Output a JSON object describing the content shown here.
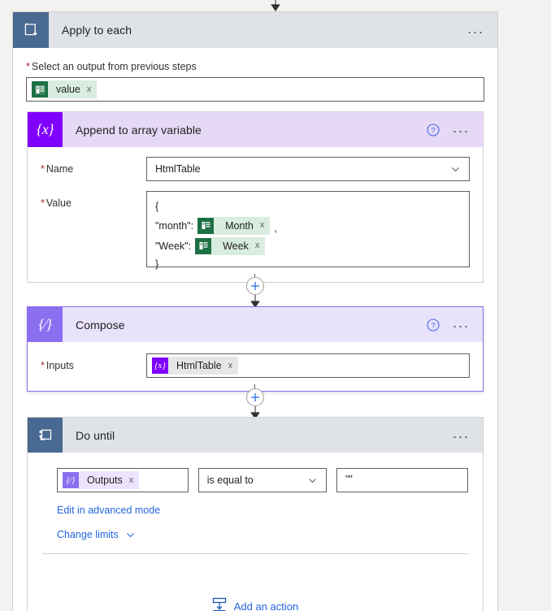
{
  "theme": {
    "page_bg": "#f3f2f1",
    "accent_blue": "#2266dd",
    "required_red": "#a4262c",
    "scope_icon_bg": "#486991",
    "variable_icon_bg": "#8000ff",
    "compose_icon_bg": "#8b6ff0",
    "excel_green": "#1d7044",
    "selected_outline": "#8b6ff0"
  },
  "apply_to_each": {
    "title": "Apply to each",
    "icon": "loop-icon",
    "menu_label": "...",
    "input": {
      "label": "Select an output from previous steps",
      "required_marker": "*",
      "token": {
        "text": "value",
        "icon": "excel-icon",
        "remove_label": "x"
      }
    }
  },
  "append_to_array": {
    "title": "Append to array variable",
    "icon": "variable-braces-icon",
    "help_label": "?",
    "menu_label": "...",
    "name_field": {
      "label": "Name",
      "required_marker": "*",
      "value": "HtmlTable",
      "chevron": "chevron-down-icon"
    },
    "value_field": {
      "label": "Value",
      "required_marker": "*",
      "lines": [
        {
          "text": "{",
          "token": null,
          "trailing": ""
        },
        {
          "text": "\"month\":",
          "token": {
            "text": "Month",
            "icon": "excel-icon",
            "remove_label": "x"
          },
          "trailing": ","
        },
        {
          "text": "\"Week\":",
          "token": {
            "text": "Week",
            "icon": "excel-icon",
            "remove_label": "x"
          },
          "trailing": ""
        },
        {
          "text": "}",
          "token": null,
          "trailing": ""
        }
      ]
    }
  },
  "compose": {
    "title": "Compose",
    "icon": "compose-braces-icon",
    "help_label": "?",
    "menu_label": "...",
    "selected": true,
    "inputs_field": {
      "label": "Inputs",
      "required_marker": "*",
      "token": {
        "text": "HtmlTable",
        "icon": "variable-braces-icon",
        "remove_label": "x"
      }
    }
  },
  "do_until": {
    "title": "Do until",
    "icon": "do-until-icon",
    "menu_label": "...",
    "condition": {
      "left_token": {
        "text": "Outputs",
        "icon": "compose-braces-icon",
        "remove_label": "x"
      },
      "operator": "is equal to",
      "operator_chevron": "chevron-down-icon",
      "right_value": "\"\"",
      "right_placeholder": ""
    },
    "advanced_link": "Edit in advanced mode",
    "change_limits_link": "Change limits",
    "change_limits_chevron": "chevron-down-icon",
    "add_action": {
      "label": "Add an action",
      "icon": "add-action-icon"
    }
  }
}
